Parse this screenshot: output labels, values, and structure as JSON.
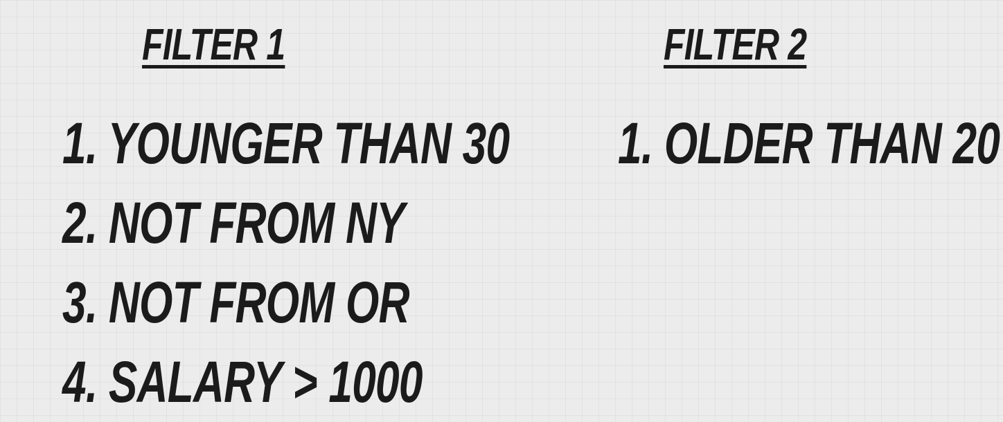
{
  "filter_1": {
    "title": "FILTER 1",
    "items": [
      "1. YOUNGER THAN 30",
      "2. NOT FROM NY",
      "3. NOT FROM OR",
      "4. SALARY > 1000"
    ]
  },
  "filter_2": {
    "title": "FILTER 2",
    "items": [
      "1. OLDER THAN 20"
    ]
  },
  "colors": {
    "background": "#ececec",
    "text": "#1b1b1b"
  }
}
